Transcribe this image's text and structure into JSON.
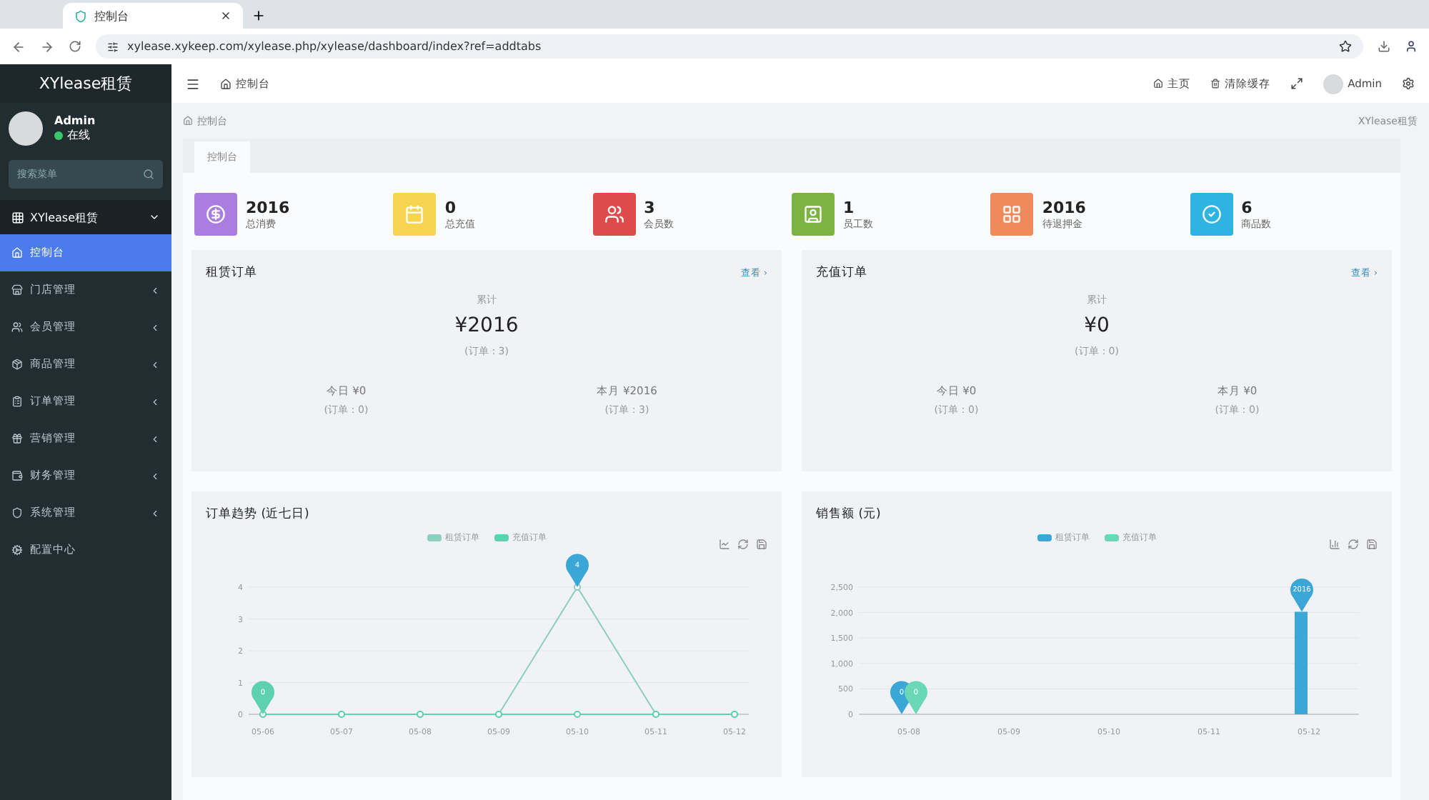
{
  "browser": {
    "tab_title": "控制台",
    "url": "xylease.xykeep.com/xylease.php/xylease/dashboard/index?ref=addtabs"
  },
  "sidebar": {
    "brand": "XYlease租赁",
    "user": {
      "name": "Admin",
      "status": "在线"
    },
    "search": {
      "placeholder": "搜索菜单"
    },
    "group": {
      "label": "XYlease租赁",
      "expanded": true
    },
    "items": [
      {
        "label": "控制台",
        "selected": true,
        "has_children": false
      },
      {
        "label": "门店管理",
        "selected": false,
        "has_children": true
      },
      {
        "label": "会员管理",
        "selected": false,
        "has_children": true
      },
      {
        "label": "商品管理",
        "selected": false,
        "has_children": true
      },
      {
        "label": "订单管理",
        "selected": false,
        "has_children": true
      },
      {
        "label": "营销管理",
        "selected": false,
        "has_children": true
      },
      {
        "label": "财务管理",
        "selected": false,
        "has_children": true
      },
      {
        "label": "系统管理",
        "selected": false,
        "has_children": true
      },
      {
        "label": "配置中心",
        "selected": false,
        "has_children": false
      }
    ]
  },
  "header": {
    "page_tab": "控制台",
    "links": [
      "主页",
      "清除缓存"
    ],
    "user": "Admin"
  },
  "breadcrumb": {
    "current": "控制台",
    "right": "XYlease租赁"
  },
  "content_tabs": [
    {
      "label": "控制台",
      "selected": true
    }
  ],
  "stats": [
    {
      "value": "2016",
      "label": "总消费",
      "color": "#a97ee0"
    },
    {
      "value": "0",
      "label": "总充值",
      "color": "#f5d44f"
    },
    {
      "value": "3",
      "label": "会员数",
      "color": "#dd4b4b"
    },
    {
      "value": "1",
      "label": "员工数",
      "color": "#7cb342"
    },
    {
      "value": "2016",
      "label": "待退押金",
      "color": "#f08a5d"
    },
    {
      "value": "6",
      "label": "商品数",
      "color": "#2fb3e0"
    }
  ],
  "order_panels": [
    {
      "title": "租赁订单",
      "link": "查看 ›",
      "total_label": "累计",
      "total": "¥2016",
      "total_orders": "(订单：3)",
      "today": "今日 ¥0",
      "today_orders": "(订单：0)",
      "month": "本月 ¥2016",
      "month_orders": "(订单：3)"
    },
    {
      "title": "充值订单",
      "link": "查看 ›",
      "total_label": "累计",
      "total": "¥0",
      "total_orders": "(订单：0)",
      "today": "今日 ¥0",
      "today_orders": "(订单：0)",
      "month": "本月 ¥0",
      "month_orders": "(订单：0)"
    }
  ],
  "charts": [
    {
      "title": "订单趋势 (近七日)",
      "chart_data": {
        "type": "line",
        "categories": [
          "05-06",
          "05-07",
          "05-08",
          "05-09",
          "05-10",
          "05-11",
          "05-12"
        ],
        "yticks": [
          0,
          1,
          2,
          3,
          4
        ],
        "ylim": [
          0,
          4
        ],
        "grid": true,
        "series": [
          {
            "name": "租赁订单",
            "color": "#8ccfc0",
            "marker": "circle",
            "values": [
              0,
              0,
              0,
              0,
              4,
              0,
              0
            ]
          },
          {
            "name": "充值订单",
            "color": "#5ed1b0",
            "marker": "circle",
            "values": [
              0,
              0,
              0,
              0,
              0,
              0,
              0
            ]
          }
        ],
        "annotations": [
          {
            "x": "05-10",
            "y": 4,
            "text": "4"
          },
          {
            "x": "05-06",
            "y": 0,
            "text": "0"
          }
        ]
      }
    },
    {
      "title": "销售额 (元)",
      "chart_data": {
        "type": "bar",
        "categories": [
          "05-08",
          "05-09",
          "05-10",
          "05-11",
          "05-12"
        ],
        "yticks": [
          {
            "value": 0,
            "label": "0"
          },
          {
            "value": 500,
            "label": "500"
          },
          {
            "value": 1000,
            "label": "1,000"
          },
          {
            "value": 1500,
            "label": "1,500"
          },
          {
            "value": 2000,
            "label": "2,000"
          },
          {
            "value": 2500,
            "label": "2,500"
          }
        ],
        "ylim": [
          0,
          2500
        ],
        "grid": true,
        "series": [
          {
            "name": "租赁订单",
            "color": "#3aa7d6",
            "values": [
              0,
              0,
              0,
              0,
              2016
            ]
          },
          {
            "name": "充值订单",
            "color": "#6ad7b5",
            "values": [
              0,
              0,
              0,
              0,
              0
            ]
          }
        ],
        "annotations": [
          {
            "x": "05-12",
            "y": 2016,
            "text": "2016"
          },
          {
            "x": "05-08",
            "y": 0,
            "text": "0"
          },
          {
            "x": "05-08",
            "y": 0,
            "text": "0"
          }
        ]
      }
    }
  ]
}
